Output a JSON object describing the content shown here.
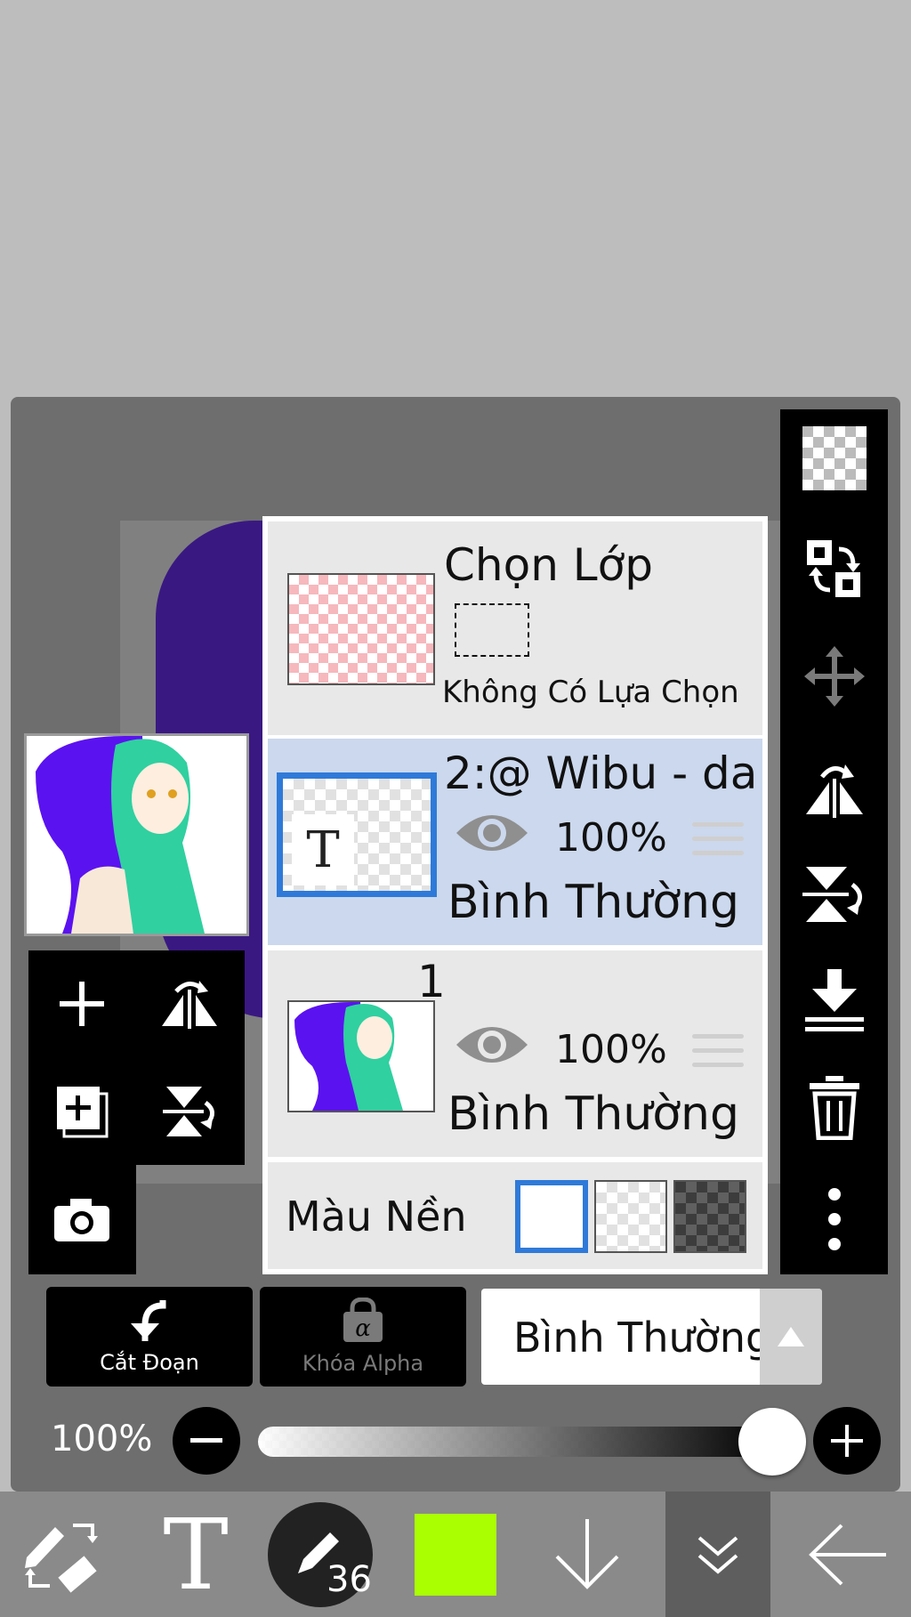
{
  "layer_panel": {
    "selection_layer": {
      "title": "Chọn Lớp",
      "subtitle": "Không Có Lựa Chọn"
    },
    "layers": [
      {
        "name": "2:@ Wibu - da",
        "opacity": "100%",
        "blend": "Bình Thường",
        "selected": true,
        "type": "text"
      },
      {
        "name": "1",
        "opacity": "100%",
        "blend": "Bình Thường",
        "selected": false,
        "type": "image"
      }
    ],
    "background": {
      "label": "Màu Nền",
      "options": [
        "white",
        "transparent",
        "dark"
      ],
      "selected": "white"
    }
  },
  "actions": {
    "clip_label": "Cắt Đoạn",
    "alpha_lock_label": "Khóa Alpha",
    "blend_mode": "Bình Thường"
  },
  "opacity": {
    "label": "100%",
    "value": 1.0
  },
  "bottom_bar": {
    "brush_size": "36",
    "current_color": "#aaff00"
  },
  "colors": {
    "accent_blue": "#2f7ad9",
    "selected_layer_bg": "#cbd8ed",
    "panel_bg": "#6e6e6e",
    "char_hair": "#30d0a0",
    "char_hood": "#5b12f0"
  }
}
